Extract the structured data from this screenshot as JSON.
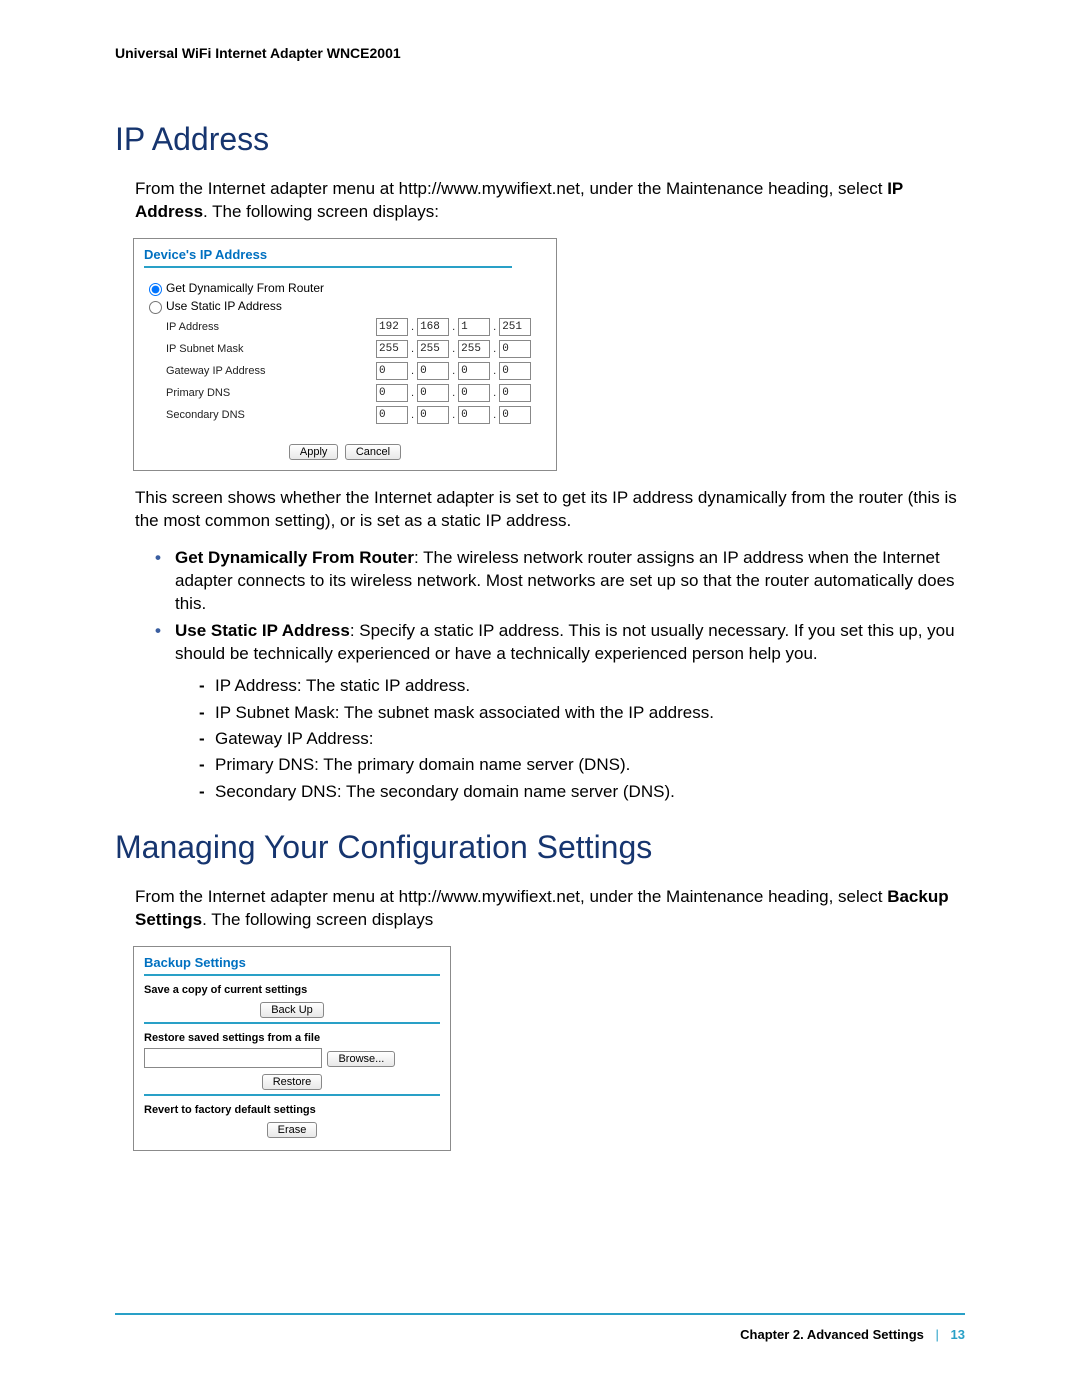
{
  "running_header": "Universal WiFi Internet Adapter WNCE2001",
  "section1": {
    "heading": "IP Address",
    "intro_a": "From the Internet adapter menu at http://www.mywifiext.net, under the Maintenance heading, select ",
    "intro_b": "IP Address",
    "intro_c": ". The following screen displays:"
  },
  "ip_panel": {
    "title": "Device's IP Address",
    "radio1": "Get Dynamically From Router",
    "radio2": "Use Static IP Address",
    "rows": [
      {
        "label": "IP Address",
        "o": [
          "192",
          "168",
          "1",
          "251"
        ]
      },
      {
        "label": "IP Subnet Mask",
        "o": [
          "255",
          "255",
          "255",
          "0"
        ]
      },
      {
        "label": "Gateway IP Address",
        "o": [
          "0",
          "0",
          "0",
          "0"
        ]
      },
      {
        "label": "Primary DNS",
        "o": [
          "0",
          "0",
          "0",
          "0"
        ]
      },
      {
        "label": "Secondary DNS",
        "o": [
          "0",
          "0",
          "0",
          "0"
        ]
      }
    ],
    "apply": "Apply",
    "cancel": "Cancel"
  },
  "after_panel": "This screen shows whether the Internet adapter is set to get its IP address dynamically from the router (this is the most common setting), or is set as a static IP address.",
  "bullets": [
    {
      "lead": "Get Dynamically From Router",
      "text": ": The wireless network router assigns an IP address when the Internet adapter connects to its wireless network. Most networks are set up so that the router automatically does this."
    },
    {
      "lead": "Use Static IP Address",
      "text": ": Specify a static IP address. This is not usually necessary. If you set this up, you should be technically experienced or have a technically experienced person help you."
    }
  ],
  "dashes": [
    "IP Address: The static IP address.",
    "IP Subnet Mask: The subnet mask associated with the IP address.",
    "Gateway IP Address:",
    "Primary DNS: The primary domain name server (DNS).",
    "Secondary DNS: The secondary domain name server (DNS)."
  ],
  "section2": {
    "heading": "Managing Your Configuration Settings",
    "intro_a": "From the Internet adapter menu at http://www.mywifiext.net, under the Maintenance heading, select ",
    "intro_b": "Backup Settings",
    "intro_c": ". The following screen displays"
  },
  "bk_panel": {
    "title": "Backup Settings",
    "save_label": "Save a copy of current settings",
    "backup": "Back Up",
    "restore_label": "Restore saved settings from a file",
    "browse": "Browse...",
    "restore": "Restore",
    "revert_label": "Revert to factory default settings",
    "erase": "Erase"
  },
  "footer": {
    "chapter": "Chapter 2.  Advanced Settings",
    "page": "13"
  }
}
